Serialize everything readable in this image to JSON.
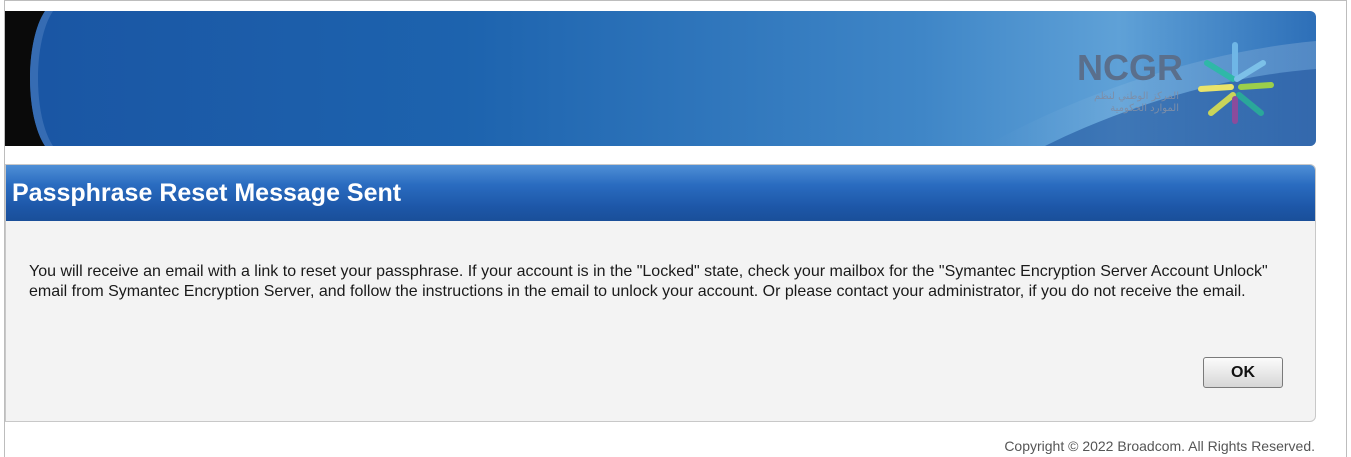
{
  "banner": {
    "logo_text": "NCGR",
    "logo_subtext": "المركز الوطني لنظم الموارد الحكومية"
  },
  "panel": {
    "title": "Passphrase Reset Message Sent",
    "message": "You will receive an email with a link to reset your passphrase. If your account is in the \"Locked\" state, check your mailbox for the \"Symantec Encryption Server Account Unlock\" email from Symantec Encryption Server, and follow the instructions in the email to unlock your account. Or please contact your administrator, if you do not receive the email.",
    "ok_label": "OK"
  },
  "footer": {
    "copyright": "Copyright © 2022 Broadcom. All Rights Reserved."
  },
  "colors": {
    "banner_blue": "#1d63ae",
    "header_blue": "#2a6cc0",
    "panel_bg": "#f3f3f3"
  }
}
